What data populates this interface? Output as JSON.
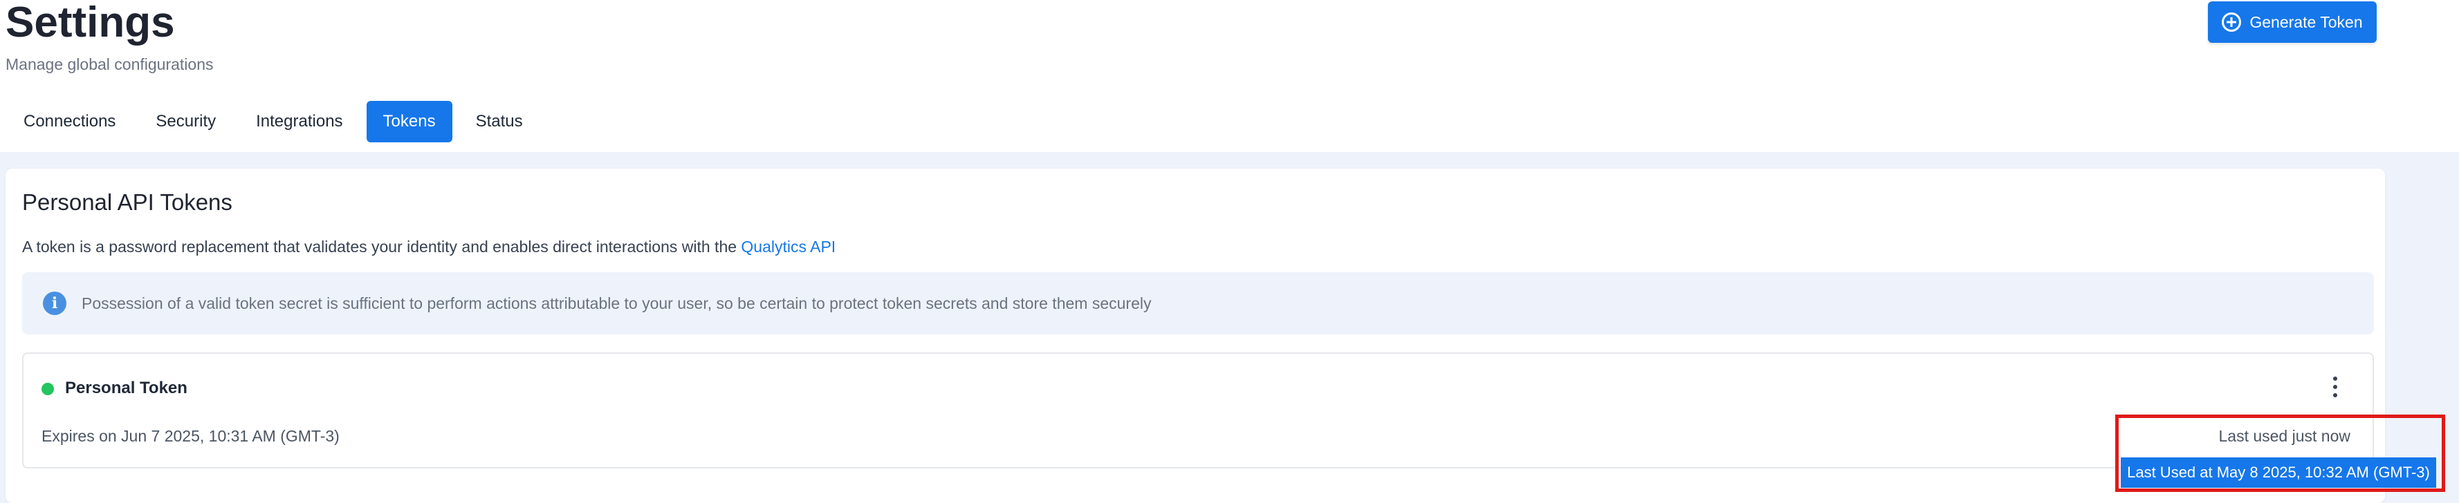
{
  "header": {
    "title": "Settings",
    "subtitle": "Manage global configurations",
    "generate_label": "Generate Token"
  },
  "tabs": [
    {
      "label": "Connections",
      "active": false
    },
    {
      "label": "Security",
      "active": false
    },
    {
      "label": "Integrations",
      "active": false
    },
    {
      "label": "Tokens",
      "active": true
    },
    {
      "label": "Status",
      "active": false
    }
  ],
  "card": {
    "title": "Personal API Tokens",
    "description": "A token is a password replacement that validates your identity and enables direct interactions with the",
    "link_label": "Qualytics API",
    "info": "Possession of a valid token secret is sufficient to perform actions attributable to your user, so be certain to protect token secrets and store them securely"
  },
  "token": {
    "name": "Personal Token",
    "status": "active",
    "expires": "Expires on Jun 7 2025, 10:31 AM (GMT-3)",
    "last_used": "Last used just now",
    "tooltip": "Last Used at May 8 2025, 10:32 AM (GMT-3)"
  },
  "icons": {
    "generate": "plus-circle-icon",
    "info": "info-icon",
    "menu": "more-vertical-icon"
  },
  "colors": {
    "accent": "#1677ea",
    "status_active": "#22c55e",
    "highlight": "#e01919"
  }
}
